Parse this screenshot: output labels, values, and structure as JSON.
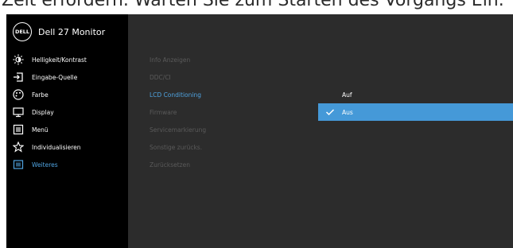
{
  "caption": "Zeit erfordern. Warten Sie zum Starten des Vorgangs Ein.",
  "brand": {
    "logo_text": "DELL",
    "model": "Dell 27 Monitor"
  },
  "sidebar": {
    "items": [
      {
        "label": "Helligkeit/Kontrast",
        "icon": "brightness-icon"
      },
      {
        "label": "Eingabe-Quelle",
        "icon": "input-source-icon"
      },
      {
        "label": "Farbe",
        "icon": "color-icon"
      },
      {
        "label": "Display",
        "icon": "display-icon"
      },
      {
        "label": "Menü",
        "icon": "menu-icon"
      },
      {
        "label": "Individualisieren",
        "icon": "star-icon"
      },
      {
        "label": "Weiteres",
        "icon": "others-icon",
        "active": true
      }
    ]
  },
  "submenu": {
    "items": [
      {
        "label": "Info Anzeigen"
      },
      {
        "label": "DDC/CI"
      },
      {
        "label": "LCD Conditioning",
        "active": true
      },
      {
        "label": "Firmware"
      },
      {
        "label": "Servicemarkierung"
      },
      {
        "label": "Sonstige zurücks."
      },
      {
        "label": "Zurücksetzen"
      }
    ]
  },
  "options": {
    "items": [
      {
        "label": "Auf",
        "selected": false
      },
      {
        "label": "Aus",
        "selected": true
      }
    ]
  },
  "colors": {
    "accent": "#4fa3e0",
    "selected_bg": "#4599d8",
    "panel_bg": "#2c2c2c",
    "sidebar_bg": "#000000"
  }
}
